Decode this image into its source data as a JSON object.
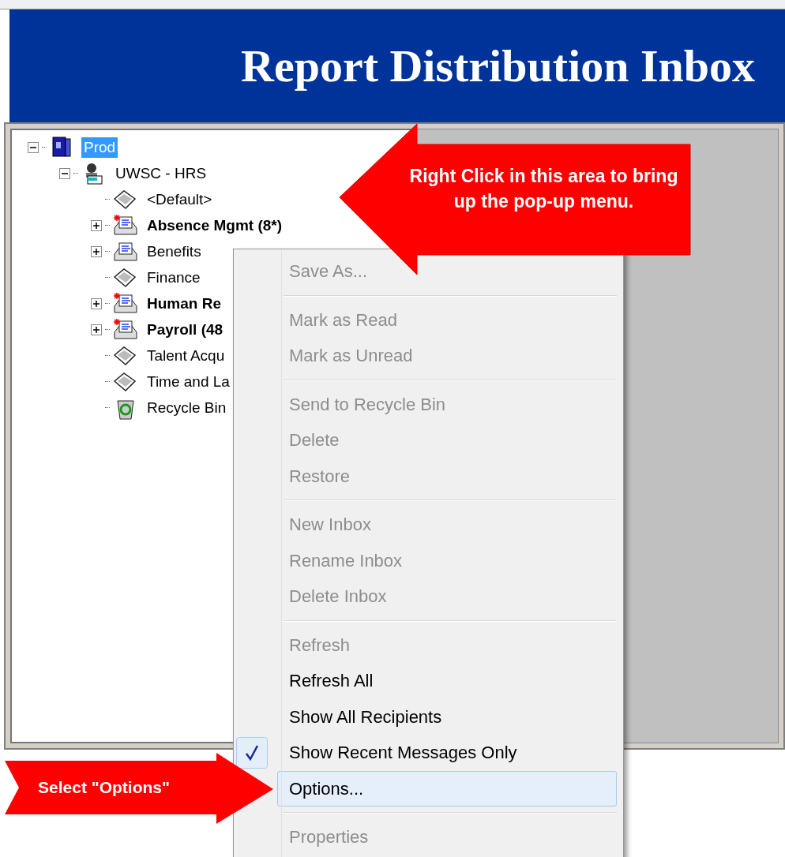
{
  "header": {
    "title": "Report Distribution Inbox"
  },
  "tree": [
    {
      "label": "Prod",
      "kind": "server",
      "selected": true,
      "expanded": true,
      "children": [
        {
          "label": "UWSC - HRS",
          "kind": "user",
          "selected": false,
          "expanded": true,
          "children": [
            {
              "label": "<Default>",
              "kind": "tray",
              "selected": false
            },
            {
              "label": "Absence Mgmt (8*)",
              "kind": "messages",
              "selected": false,
              "unread": true,
              "expanded": false
            },
            {
              "label": "Benefits",
              "kind": "messages",
              "selected": false,
              "unread": false,
              "expanded": false
            },
            {
              "label": "Finance",
              "kind": "tray",
              "selected": false
            },
            {
              "label": "Human Re",
              "kind": "messages",
              "selected": false,
              "unread": true,
              "expanded": false
            },
            {
              "label": "Payroll (48",
              "kind": "messages",
              "selected": false,
              "unread": true,
              "expanded": false
            },
            {
              "label": "Talent Acqu",
              "kind": "tray",
              "selected": false
            },
            {
              "label": "Time and La",
              "kind": "tray",
              "selected": false
            },
            {
              "label": "Recycle Bin",
              "kind": "recycle",
              "selected": false
            }
          ]
        }
      ]
    }
  ],
  "context_menu": {
    "groups": [
      {
        "items": [
          {
            "label": "Save As...",
            "disabled": true,
            "checked": false,
            "selected": false
          }
        ]
      },
      {
        "items": [
          {
            "label": "Mark as Read",
            "disabled": true,
            "checked": false,
            "selected": false
          },
          {
            "label": "Mark as Unread",
            "disabled": true,
            "checked": false,
            "selected": false
          }
        ]
      },
      {
        "items": [
          {
            "label": "Send to Recycle Bin",
            "disabled": true,
            "checked": false,
            "selected": false
          },
          {
            "label": "Delete",
            "disabled": true,
            "checked": false,
            "selected": false
          },
          {
            "label": "Restore",
            "disabled": true,
            "checked": false,
            "selected": false
          }
        ]
      },
      {
        "items": [
          {
            "label": "New Inbox",
            "disabled": true,
            "checked": false,
            "selected": false
          },
          {
            "label": "Rename Inbox",
            "disabled": true,
            "checked": false,
            "selected": false
          },
          {
            "label": "Delete Inbox",
            "disabled": true,
            "checked": false,
            "selected": false
          }
        ]
      },
      {
        "items": [
          {
            "label": "Refresh",
            "disabled": true,
            "checked": false,
            "selected": false
          },
          {
            "label": "Refresh All",
            "disabled": false,
            "checked": false,
            "selected": false
          },
          {
            "label": "Show All Recipients",
            "disabled": false,
            "checked": false,
            "selected": false
          },
          {
            "label": "Show Recent Messages Only",
            "disabled": false,
            "checked": true,
            "selected": false
          },
          {
            "label": "Options...",
            "disabled": false,
            "checked": false,
            "selected": true
          }
        ]
      },
      {
        "items": [
          {
            "label": "Properties",
            "disabled": true,
            "checked": false,
            "selected": false
          }
        ]
      }
    ]
  },
  "callouts": [
    {
      "text": "Right Click in this area to bring up the pop-up menu.",
      "kind": "left"
    },
    {
      "text": "Select \"Options\"",
      "kind": "right"
    }
  ]
}
